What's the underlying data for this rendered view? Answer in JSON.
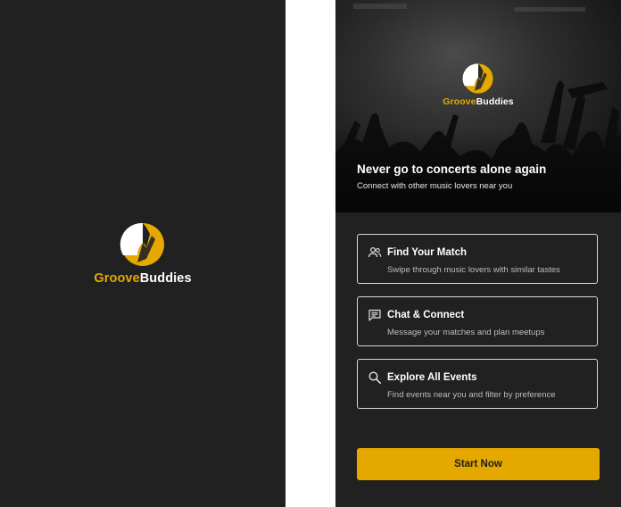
{
  "brand": {
    "name_part1": "Groove",
    "name_part2": "Buddies",
    "accent": "#e4a800",
    "background": "#212121"
  },
  "splash": {
    "logo_icon": "music-note-logo-icon"
  },
  "onboarding": {
    "headline": "Never go to concerts alone again",
    "subheadline": "Connect with other music lovers near you",
    "hero_image": "concert-crowd-photo",
    "features": [
      {
        "icon": "people-icon",
        "title": "Find Your Match",
        "description": "Swipe through music lovers with similar tastes"
      },
      {
        "icon": "chat-icon",
        "title": "Chat & Connect",
        "description": "Message your matches and plan meetups"
      },
      {
        "icon": "search-icon",
        "title": "Explore All Events",
        "description": "Find events near you and filter by preference"
      }
    ],
    "cta_label": "Start Now"
  }
}
